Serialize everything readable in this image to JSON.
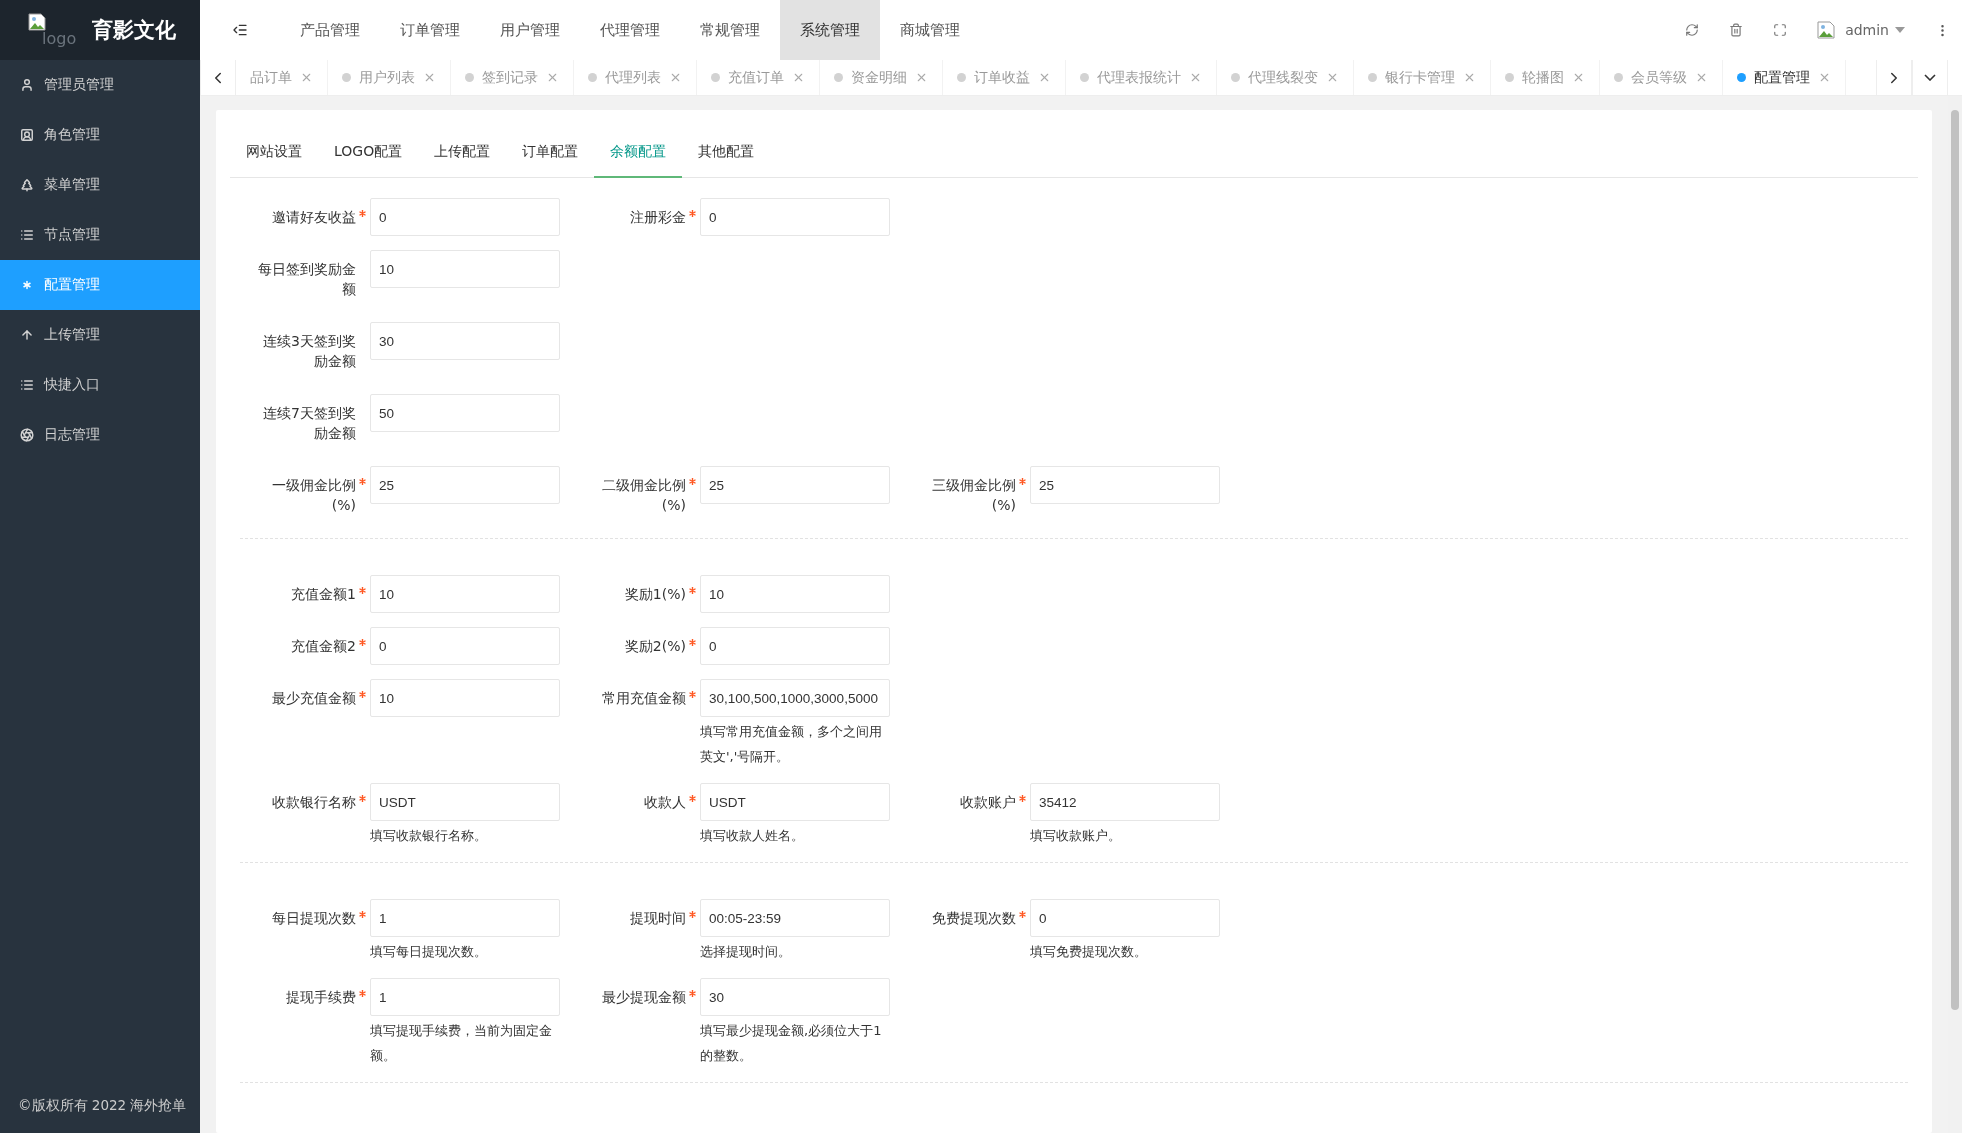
{
  "sidebar": {
    "logo_alt": "logo",
    "brand": "育影文化",
    "items": [
      {
        "label": "管理员管理",
        "selected": false
      },
      {
        "label": "角色管理",
        "selected": false
      },
      {
        "label": "菜单管理",
        "selected": false
      },
      {
        "label": "节点管理",
        "selected": false
      },
      {
        "label": "配置管理",
        "selected": true
      },
      {
        "label": "上传管理",
        "selected": false
      },
      {
        "label": "快捷入口",
        "selected": false
      },
      {
        "label": "日志管理",
        "selected": false
      }
    ],
    "footer": "©版权所有 2022 海外抢单"
  },
  "topnav": {
    "items": [
      {
        "label": "产品管理",
        "selected": false
      },
      {
        "label": "订单管理",
        "selected": false
      },
      {
        "label": "用户管理",
        "selected": false
      },
      {
        "label": "代理管理",
        "selected": false
      },
      {
        "label": "常规管理",
        "selected": false
      },
      {
        "label": "系统管理",
        "selected": true
      },
      {
        "label": "商城管理",
        "selected": false
      }
    ],
    "user": "admin"
  },
  "page_tabs": [
    {
      "label": "品订单",
      "dot": false,
      "selected": false
    },
    {
      "label": "用户列表",
      "dot": true,
      "selected": false
    },
    {
      "label": "签到记录",
      "dot": true,
      "selected": false
    },
    {
      "label": "代理列表",
      "dot": true,
      "selected": false
    },
    {
      "label": "充值订单",
      "dot": true,
      "selected": false
    },
    {
      "label": "资金明细",
      "dot": true,
      "selected": false
    },
    {
      "label": "订单收益",
      "dot": true,
      "selected": false
    },
    {
      "label": "代理表报统计",
      "dot": true,
      "selected": false
    },
    {
      "label": "代理线裂变",
      "dot": true,
      "selected": false
    },
    {
      "label": "银行卡管理",
      "dot": true,
      "selected": false
    },
    {
      "label": "轮播图",
      "dot": true,
      "selected": false
    },
    {
      "label": "会员等级",
      "dot": true,
      "selected": false
    },
    {
      "label": "配置管理",
      "dot": true,
      "selected": true
    }
  ],
  "config_tabs": [
    {
      "label": "网站设置",
      "selected": false
    },
    {
      "label": "LOGO配置",
      "selected": false
    },
    {
      "label": "上传配置",
      "selected": false
    },
    {
      "label": "订单配置",
      "selected": false
    },
    {
      "label": "余额配置",
      "selected": true
    },
    {
      "label": "其他配置",
      "selected": false
    }
  ],
  "sections": [
    {
      "rows": [
        [
          {
            "label": "邀请好友收益",
            "value": "0",
            "required": true
          },
          {
            "label": "注册彩金",
            "value": "0",
            "required": true
          }
        ],
        [
          {
            "label": "每日签到奖励金额",
            "value": "10",
            "required": false
          }
        ],
        [
          {
            "label": "连续3天签到奖励金额",
            "value": "30",
            "required": false
          }
        ],
        [
          {
            "label": "连续7天签到奖励金额",
            "value": "50",
            "required": false
          }
        ],
        [
          {
            "label": "一级佣金比例(%)",
            "value": "25",
            "required": true
          },
          {
            "label": "二级佣金比例(%)",
            "value": "25",
            "required": true
          },
          {
            "label": "三级佣金比例(%)",
            "value": "25",
            "required": true
          }
        ]
      ]
    },
    {
      "rows": [
        [
          {
            "label": "充值金额1",
            "value": "10",
            "required": true
          },
          {
            "label": "奖励1(%)",
            "value": "10",
            "required": true
          }
        ],
        [
          {
            "label": "充值金额2",
            "value": "0",
            "required": true
          },
          {
            "label": "奖励2(%)",
            "value": "0",
            "required": true
          }
        ],
        [
          {
            "label": "最少充值金额",
            "value": "10",
            "required": true
          },
          {
            "label": "常用充值金额",
            "value": "30,100,500,1000,3000,5000",
            "required": true,
            "help": "填写常用充值金额，多个之间用英文','号隔开。"
          }
        ],
        [
          {
            "label": "收款银行名称",
            "value": "USDT",
            "required": true,
            "help": "填写收款银行名称。"
          },
          {
            "label": "收款人",
            "value": "USDT",
            "required": true,
            "help": "填写收款人姓名。"
          },
          {
            "label": "收款账户",
            "value": "35412",
            "required": true,
            "help": "填写收款账户。"
          }
        ]
      ]
    },
    {
      "rows": [
        [
          {
            "label": "每日提现次数",
            "value": "1",
            "required": true,
            "help": "填写每日提现次数。"
          },
          {
            "label": "提现时间",
            "value": "00:05-23:59",
            "required": true,
            "help": "选择提现时间。"
          },
          {
            "label": "免费提现次数",
            "value": "0",
            "required": true,
            "help": "填写免费提现次数。"
          }
        ],
        [
          {
            "label": "提现手续费",
            "value": "1",
            "required": true,
            "help": "填写提现手续费，当前为固定金额。"
          },
          {
            "label": "最少提现金额",
            "value": "30",
            "required": true,
            "help": "填写最少提现金额,必须位大于1的整数。"
          }
        ]
      ]
    }
  ]
}
